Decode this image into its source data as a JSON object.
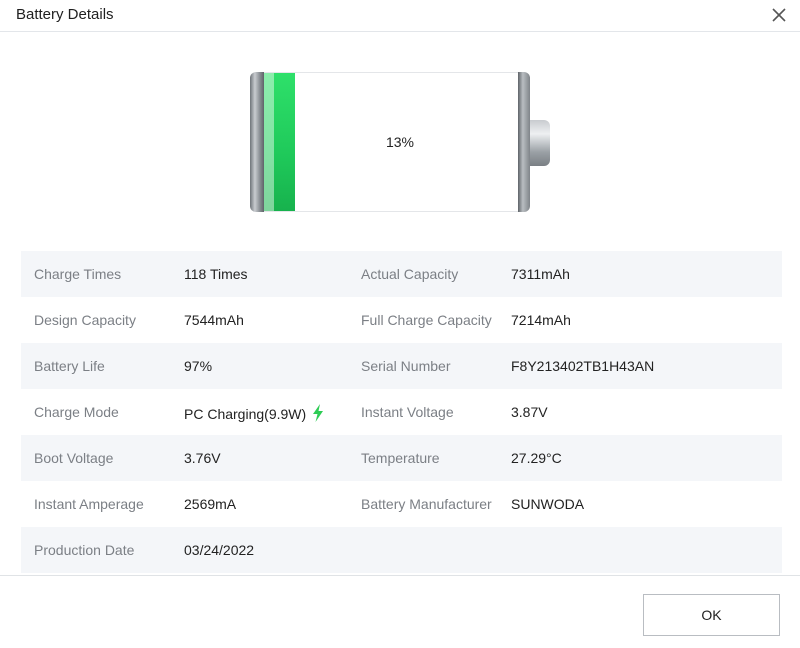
{
  "window": {
    "title": "Battery Details"
  },
  "battery": {
    "percent_text": "13%",
    "level": 0.13,
    "fill_color": "#1fc95a"
  },
  "details": [
    {
      "label1": "Charge Times",
      "value1": "118 Times",
      "label2": "Actual Capacity",
      "value2": "7311mAh"
    },
    {
      "label1": "Design Capacity",
      "value1": "7544mAh",
      "label2": "Full Charge Capacity",
      "value2": "7214mAh"
    },
    {
      "label1": "Battery Life",
      "value1": "97%",
      "label2": "Serial Number",
      "value2": "F8Y213402TB1H43AN"
    },
    {
      "label1": "Charge Mode",
      "value1": "PC Charging(9.9W)",
      "label2": "Instant Voltage",
      "value2": "3.87V",
      "icon": "lightning-icon"
    },
    {
      "label1": "Boot Voltage",
      "value1": "3.76V",
      "label2": "Temperature",
      "value2": "27.29°C"
    },
    {
      "label1": "Instant Amperage",
      "value1": "2569mA",
      "label2": "Battery Manufacturer",
      "value2": "SUNWODA"
    },
    {
      "label1": "Production Date",
      "value1": "03/24/2022",
      "label2": "",
      "value2": ""
    }
  ],
  "footer": {
    "ok_label": "OK"
  },
  "colors": {
    "row_alt_bg": "#f4f6f9",
    "label_color": "#7b7f85",
    "charge_icon": "#2ecc55"
  }
}
